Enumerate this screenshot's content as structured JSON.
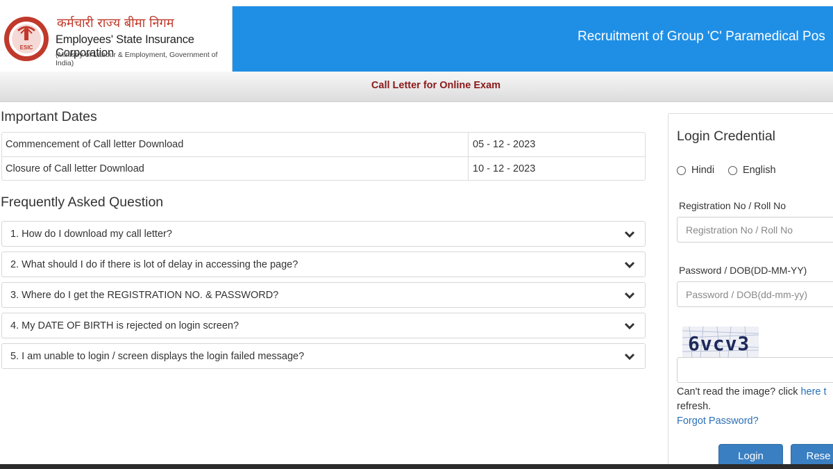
{
  "header": {
    "org_hindi": "कर्मचारी राज्य बीमा निगम",
    "org_name": "Employees' State Insurance Corporation",
    "org_sub": "(Ministry of Labour & Employment, Government of India)",
    "logo_text": "ESIC",
    "title": "Recruitment of Group 'C' Paramedical Pos"
  },
  "subbar": {
    "title": "Call Letter for Online Exam"
  },
  "important_dates": {
    "heading": "Important Dates",
    "rows": [
      {
        "label": "Commencement of Call letter Download",
        "value": "05 - 12 - 2023"
      },
      {
        "label": "Closure of Call letter Download",
        "value": "10 - 12 - 2023"
      }
    ]
  },
  "faq": {
    "heading": "Frequently Asked Question",
    "items": [
      "1. How do I download my call letter?",
      "2. What should I do if there is lot of delay in accessing the page?",
      "3. Where do I get the REGISTRATION NO. & PASSWORD?",
      "4. My DATE OF BIRTH is rejected on login screen?",
      "5. I am unable to login / screen displays the login failed message?"
    ]
  },
  "login": {
    "heading": "Login Credential",
    "lang_hindi": "Hindi",
    "lang_english": "English",
    "reg_label": "Registration No / Roll No",
    "reg_placeholder": "Registration No / Roll No",
    "pwd_label": "Password / DOB(DD-MM-YY)",
    "pwd_placeholder": "Password / DOB(dd-mm-yy)",
    "captcha_text": "6vcv3",
    "help_prefix": "Can't read the image? click ",
    "help_link": "here t",
    "help_suffix": "refresh.",
    "forgot": "Forgot Password?",
    "login_btn": "Login",
    "reset_btn": "Rese"
  },
  "colors": {
    "header_blue": "#1f8fe6",
    "title_red": "#8b1a1a",
    "button_blue": "#3a7fc2",
    "link_blue": "#2a6fb5"
  }
}
